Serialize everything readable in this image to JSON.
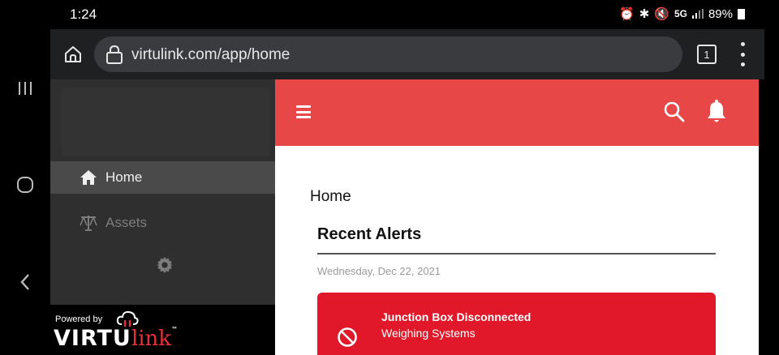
{
  "status": {
    "time": "1:24",
    "signal": "5G",
    "battery": "89%"
  },
  "browser": {
    "url": "virtulink.com/app/home",
    "tab_count": "1"
  },
  "sidebar": {
    "items": [
      {
        "label": "Home",
        "icon": "home-icon",
        "active": true
      },
      {
        "label": "Assets",
        "icon": "scale-icon",
        "active": false
      }
    ],
    "powered_by": "Powered by",
    "brand_main": "VIRTU",
    "brand_link": "link",
    "brand_tm": "™"
  },
  "main": {
    "page_title": "Home",
    "section_title": "Recent Alerts",
    "date": "Wednesday, Dec 22, 2021",
    "alerts": [
      {
        "title": "Junction Box Disconnected",
        "subtitle": "Weighing Systems"
      }
    ]
  },
  "colors": {
    "accent": "#e84747",
    "alert": "#e0182a",
    "sidebar": "#2f2f2f"
  }
}
